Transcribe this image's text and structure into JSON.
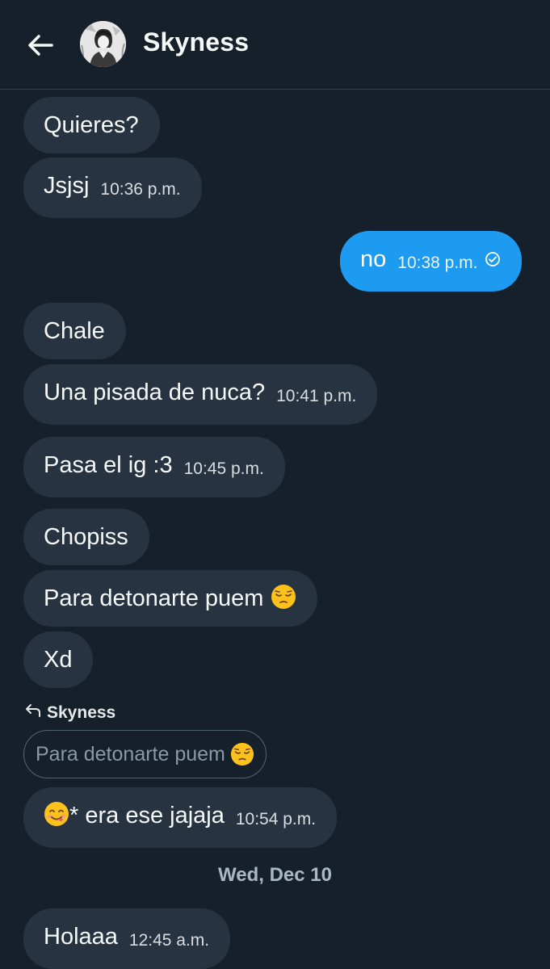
{
  "header": {
    "title": "Skyness"
  },
  "messages": [
    {
      "text": "Quieres?",
      "time": ""
    },
    {
      "text": "Jsjsj",
      "time": "10:36 p.m."
    },
    {
      "text": "no",
      "time": "10:38 p.m."
    },
    {
      "text": "Chale",
      "time": ""
    },
    {
      "text": "Una pisada de nuca?",
      "time": "10:41 p.m."
    },
    {
      "text": "Pasa el ig :3",
      "time": "10:45 p.m."
    },
    {
      "text": "Chopiss",
      "time": ""
    },
    {
      "text": "Para detonarte puem",
      "time": ""
    },
    {
      "text": "Xd",
      "time": ""
    },
    {
      "text": "* era ese jajaja",
      "time": "10:54 p.m."
    },
    {
      "text": "Holaaa",
      "time": "12:45 a.m."
    }
  ],
  "reply": {
    "author": "Skyness",
    "quoted_text": "Para detonarte puem"
  },
  "date_separator": "Wed, Dec 10",
  "icons": {
    "back": "arrow-left-icon",
    "read": "check-circle-icon",
    "reply": "reply-arrow-icon",
    "pensive": "pensive-face-emoji",
    "yum": "yum-face-emoji"
  },
  "colors": {
    "background": "#15202b",
    "incoming_bubble": "#273340",
    "outgoing_bubble": "#1d9bf0"
  }
}
